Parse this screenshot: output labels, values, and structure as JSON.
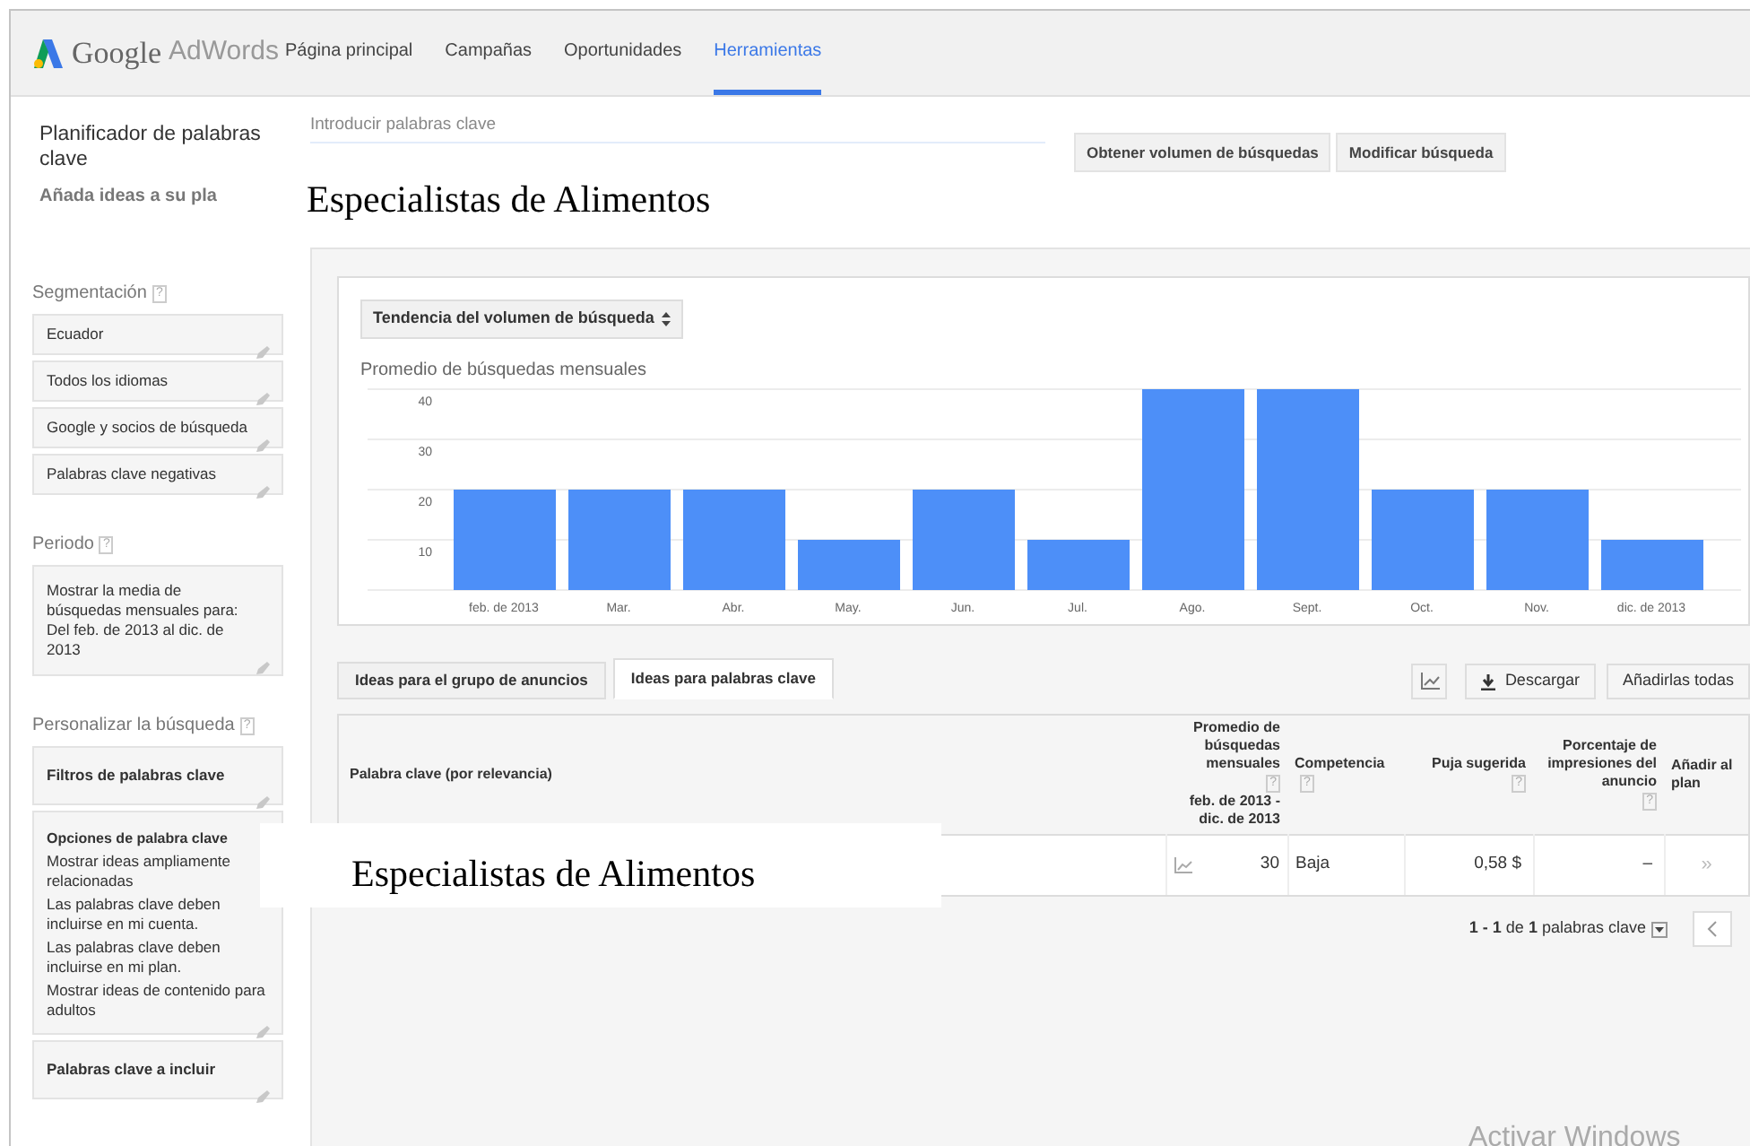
{
  "header": {
    "logo_google": "Google",
    "logo_product": "AdWords",
    "nav": [
      {
        "label": "Página principal",
        "selected": false
      },
      {
        "label": "Campañas",
        "selected": false
      },
      {
        "label": "Oportunidades",
        "selected": false
      },
      {
        "label": "Herramientas",
        "selected": true
      }
    ]
  },
  "planner": {
    "title": "Planificador de palabras clave",
    "subtitle": "Añada ideas a su pla"
  },
  "keyword_input": {
    "placeholder": "Introducir palabras clave"
  },
  "top_buttons": [
    "Obtener volumen de búsquedas",
    "Modificar búsqueda"
  ],
  "overlays": [
    {
      "text": "Especialistas de Alimentos"
    },
    {
      "text": "Especialistas de Alimentos"
    }
  ],
  "sidebar": {
    "sections": [
      {
        "title": "Segmentación",
        "help": "?",
        "items": [
          {
            "kind": "edit",
            "text": "Ecuador"
          },
          {
            "kind": "edit",
            "text": "Todos los idiomas"
          },
          {
            "kind": "edit",
            "text": "Google y socios de búsqueda"
          },
          {
            "kind": "edit",
            "text": "Palabras clave negativas"
          }
        ]
      },
      {
        "title": "Periodo",
        "help": "?",
        "items": [
          {
            "kind": "edit",
            "text": "Mostrar la media de búsquedas mensuales para: Del feb. de 2013 al dic. de 2013"
          }
        ]
      },
      {
        "title": "Personalizar la búsqueda",
        "help": "?",
        "items": [
          {
            "kind": "bold",
            "text": "Filtros de palabras clave"
          },
          {
            "kind": "options",
            "text": "Opciones de palabra clave",
            "lines": [
              "Mostrar ideas ampliamente relacionadas",
              "Las palabras clave deben incluirse en mi cuenta.",
              "Las palabras clave deben incluirse en mi plan.",
              "Mostrar ideas de contenido para adultos"
            ]
          },
          {
            "kind": "bold",
            "text": "Palabras clave a incluir"
          }
        ]
      }
    ]
  },
  "chart": {
    "dropdown": "Tendencia del volumen de búsqueda",
    "chart_data": {
      "type": "bar",
      "title": "Promedio de búsquedas mensuales",
      "categories": [
        "feb. de 2013",
        "Mar.",
        "Abr.",
        "May.",
        "Jun.",
        "Jul.",
        "Ago.",
        "Sept.",
        "Oct.",
        "Nov.",
        "dic. de 2013"
      ],
      "grid": true,
      "series": [
        {
          "color": "#4d8ff8",
          "values": [
            20,
            20,
            20,
            10,
            20,
            10,
            40,
            40,
            20,
            20,
            10
          ]
        }
      ],
      "ylim": [
        0,
        40
      ],
      "yticks": [
        10,
        20,
        30,
        40
      ]
    }
  },
  "tabs": [
    {
      "label": "Ideas para el grupo de anuncios",
      "selected": false
    },
    {
      "label": "Ideas para palabras clave",
      "selected": true
    }
  ],
  "toolbar": {
    "download": "Descargar",
    "add_all": "Añadirlas todas"
  },
  "table": {
    "columns": [
      {
        "label": "Palabra clave (por relevancia)"
      },
      {
        "label": "Promedio de búsquedas mensuales",
        "help": "?",
        "sub": "feb. de 2013 - dic. de 2013"
      },
      {
        "label": "Competencia",
        "help": "?"
      },
      {
        "label": "Puja sugerida",
        "help": "?"
      },
      {
        "label": "Porcentaje de impresiones del anuncio",
        "help": "?"
      },
      {
        "label": "Añadir al plan"
      }
    ],
    "rows": [
      {
        "searches": "30",
        "competition": "Baja",
        "bid": "0,58 $",
        "impression_share": "–",
        "add": "»"
      }
    ]
  },
  "pagination": {
    "summary": "**1 - 1** de **1** palabras clave"
  },
  "os_notice": "Activar Windows"
}
